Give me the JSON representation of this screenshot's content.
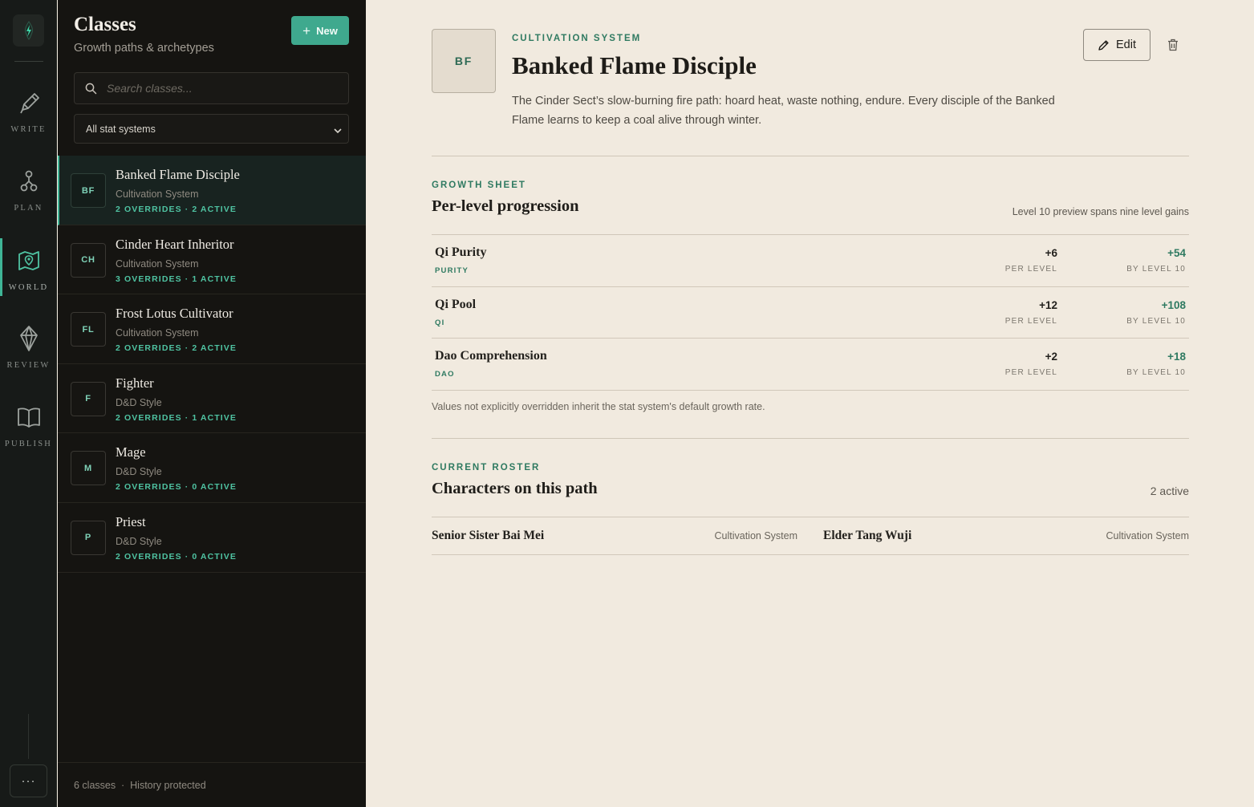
{
  "rail": {
    "items": [
      {
        "label": "WRITE",
        "icon": "pen-icon"
      },
      {
        "label": "PLAN",
        "icon": "plan-nodes-icon"
      },
      {
        "label": "WORLD",
        "icon": "map-icon"
      },
      {
        "label": "REVIEW",
        "icon": "diamond-icon"
      },
      {
        "label": "PUBLISH",
        "icon": "book-icon"
      }
    ],
    "active": "WORLD",
    "more_label": "···"
  },
  "panel": {
    "title": "Classes",
    "subtitle": "Growth paths & archetypes",
    "new_label": "New",
    "search_placeholder": "Search classes...",
    "filter_value": "All stat systems",
    "items": [
      {
        "badge": "BF",
        "name": "Banked Flame Disciple",
        "system": "Cultivation System",
        "meta": "2 OVERRIDES · 2 ACTIVE"
      },
      {
        "badge": "CH",
        "name": "Cinder Heart Inheritor",
        "system": "Cultivation System",
        "meta": "3 OVERRIDES · 1 ACTIVE"
      },
      {
        "badge": "FL",
        "name": "Frost Lotus Cultivator",
        "system": "Cultivation System",
        "meta": "2 OVERRIDES · 2 ACTIVE"
      },
      {
        "badge": "F",
        "name": "Fighter",
        "system": "D&D Style",
        "meta": "2 OVERRIDES · 1 ACTIVE"
      },
      {
        "badge": "M",
        "name": "Mage",
        "system": "D&D Style",
        "meta": "2 OVERRIDES · 0 ACTIVE"
      },
      {
        "badge": "P",
        "name": "Priest",
        "system": "D&D Style",
        "meta": "2 OVERRIDES · 0 ACTIVE"
      }
    ],
    "footer": "6 classes  ·  History protected"
  },
  "detail": {
    "badge": "BF",
    "kicker": "CULTIVATION SYSTEM",
    "title": "Banked Flame Disciple",
    "description": "The Cinder Sect’s slow-burning fire path: hoard heat, waste nothing, endure. Every disciple of the Banked Flame learns to keep a coal alive through winter.",
    "edit_label": "Edit",
    "growth": {
      "kicker": "GROWTH SHEET",
      "title": "Per-level progression",
      "note": "Level 10 preview spans nine level gains",
      "stats": [
        {
          "name": "Qi Purity",
          "code": "PURITY",
          "per": "+6",
          "per_label": "PER LEVEL",
          "total": "+54",
          "total_label": "BY LEVEL 10"
        },
        {
          "name": "Qi Pool",
          "code": "QI",
          "per": "+12",
          "per_label": "PER LEVEL",
          "total": "+108",
          "total_label": "BY LEVEL 10"
        },
        {
          "name": "Dao Comprehension",
          "code": "DAO",
          "per": "+2",
          "per_label": "PER LEVEL",
          "total": "+18",
          "total_label": "BY LEVEL 10"
        }
      ],
      "footnote": "Values not explicitly overridden inherit the stat system's default growth rate."
    },
    "roster": {
      "kicker": "CURRENT ROSTER",
      "title": "Characters on this path",
      "count": "2 active",
      "characters": [
        {
          "name": "Senior Sister Bai Mei",
          "system": "Cultivation System"
        },
        {
          "name": "Elder Tang Wuji",
          "system": "Cultivation System"
        }
      ]
    }
  },
  "colors": {
    "accent": "#3fb596",
    "accent_dark": "#2f7a61",
    "rail_bg": "#171a18",
    "panel_bg": "#151411",
    "main_bg": "#f1eadf"
  }
}
